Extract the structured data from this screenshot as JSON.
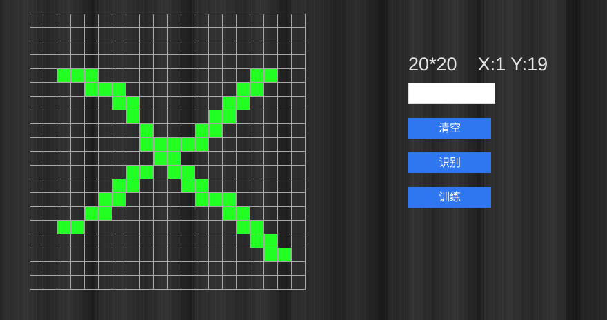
{
  "info": {
    "grid_size": "20*20",
    "coords": "X:1 Y:19"
  },
  "result_box": {
    "value": ""
  },
  "buttons": {
    "clear": "清空",
    "recognize": "识别",
    "train": "训练"
  },
  "grid": {
    "rows": 20,
    "cols": 20,
    "filled_color": "#22ff22",
    "line_color": "#a8a8a8",
    "filled_cells": [
      [
        4,
        2
      ],
      [
        4,
        3
      ],
      [
        4,
        4
      ],
      [
        4,
        16
      ],
      [
        4,
        17
      ],
      [
        5,
        4
      ],
      [
        5,
        5
      ],
      [
        5,
        6
      ],
      [
        5,
        15
      ],
      [
        5,
        16
      ],
      [
        6,
        6
      ],
      [
        6,
        7
      ],
      [
        6,
        14
      ],
      [
        6,
        15
      ],
      [
        7,
        7
      ],
      [
        7,
        13
      ],
      [
        7,
        14
      ],
      [
        8,
        8
      ],
      [
        8,
        12
      ],
      [
        8,
        13
      ],
      [
        9,
        8
      ],
      [
        9,
        9
      ],
      [
        9,
        10
      ],
      [
        9,
        11
      ],
      [
        9,
        12
      ],
      [
        10,
        9
      ],
      [
        10,
        10
      ],
      [
        11,
        7
      ],
      [
        11,
        8
      ],
      [
        11,
        10
      ],
      [
        11,
        11
      ],
      [
        12,
        6
      ],
      [
        12,
        7
      ],
      [
        12,
        11
      ],
      [
        12,
        12
      ],
      [
        13,
        5
      ],
      [
        13,
        6
      ],
      [
        13,
        12
      ],
      [
        13,
        13
      ],
      [
        13,
        14
      ],
      [
        14,
        4
      ],
      [
        14,
        5
      ],
      [
        14,
        14
      ],
      [
        14,
        15
      ],
      [
        15,
        2
      ],
      [
        15,
        3
      ],
      [
        15,
        15
      ],
      [
        15,
        16
      ],
      [
        16,
        16
      ],
      [
        16,
        17
      ],
      [
        17,
        17
      ],
      [
        17,
        18
      ]
    ]
  }
}
